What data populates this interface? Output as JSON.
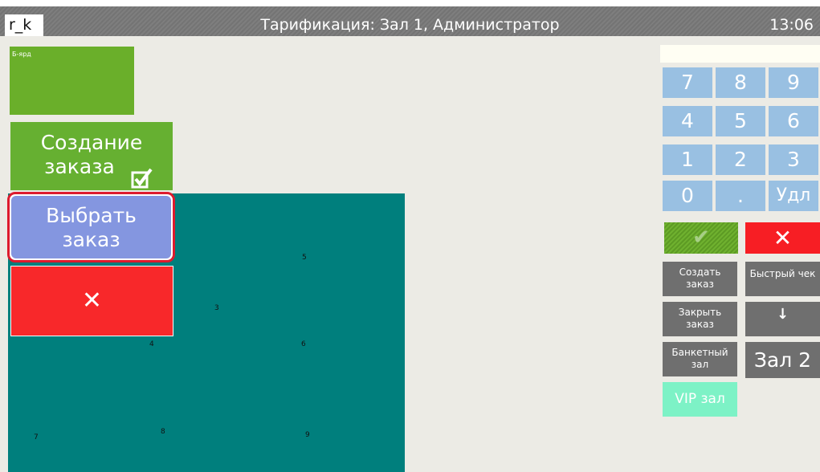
{
  "header": {
    "logo": "r_k",
    "title": "Тарификация: Зал 1, Администратор",
    "clock": "13:06"
  },
  "left_panel": {
    "hall_tile_label": "Б-ярд",
    "create_order_line1": "Создание",
    "create_order_line2": "заказа",
    "select_order_line1": "Выбрать",
    "select_order_line2": "заказ",
    "cancel_glyph": "✕"
  },
  "floor_plan": {
    "table_numbers": [
      "3",
      "4",
      "5",
      "6",
      "7",
      "8",
      "9"
    ]
  },
  "keypad": {
    "keys": [
      "7",
      "8",
      "9",
      "4",
      "5",
      "6",
      "1",
      "2",
      "3",
      "0",
      ".",
      "Удл"
    ],
    "ok_glyph": "✔",
    "cancel_glyph": "✕"
  },
  "actions": {
    "create_order_line1": "Создать",
    "create_order_line2": "заказ",
    "quick_check": "Быстрый чек",
    "close_order_line1": "Закрыть",
    "close_order_line2": "заказ",
    "down_arrow": "↓",
    "banquet_line1": "Банкетный",
    "banquet_line2": "зал",
    "hall2": "Зал 2",
    "vip": "VIP зал"
  },
  "colors": {
    "floor": "#007f7d",
    "green": "#66b031",
    "select_blue": "#8496e0",
    "red": "#f8282a",
    "keypad_blue": "#99c0e2",
    "vip": "#7df2c6"
  }
}
